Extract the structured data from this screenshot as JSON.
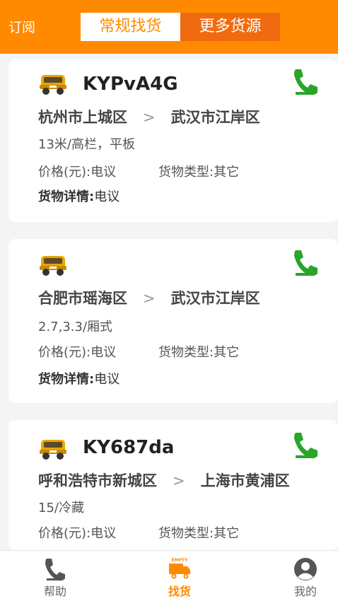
{
  "header": {
    "subscribe": "订阅",
    "tabs": [
      {
        "label": "常规找货",
        "active": true
      },
      {
        "label": "更多货源",
        "active": false
      }
    ]
  },
  "colors": {
    "accent": "#ff8a00",
    "tab_inactive": "#f06a10",
    "phone_green": "#2aa52a"
  },
  "cards": [
    {
      "code": "KYPvA4G",
      "from": "杭州市上城区",
      "arrow": ">",
      "to": "武汉市江岸区",
      "spec": "13米/高栏，平板",
      "price": "价格(元):电议",
      "cargo_type": "货物类型:其它",
      "detail_label": "货物详情:",
      "detail_value": "电议"
    },
    {
      "code": "",
      "from": "合肥市瑶海区",
      "arrow": ">",
      "to": "武汉市江岸区",
      "spec": "2.7,3.3/厢式",
      "price": "价格(元):电议",
      "cargo_type": "货物类型:其它",
      "detail_label": "货物详情:",
      "detail_value": "电议"
    },
    {
      "code": "KY687da",
      "from": "呼和浩特市新城区",
      "arrow": ">",
      "to": "上海市黄浦区",
      "spec": "15/冷藏",
      "price": "价格(元):电议",
      "cargo_type": "货物类型:其它",
      "detail_label": "",
      "detail_value": ""
    }
  ],
  "bottom_nav": [
    {
      "label": "帮助",
      "icon": "phone-help-icon",
      "active": false
    },
    {
      "label": "找货",
      "icon": "empty-truck-icon",
      "active": true,
      "badge": "EMPTY"
    },
    {
      "label": "我的",
      "icon": "user-profile-icon",
      "active": false
    }
  ]
}
